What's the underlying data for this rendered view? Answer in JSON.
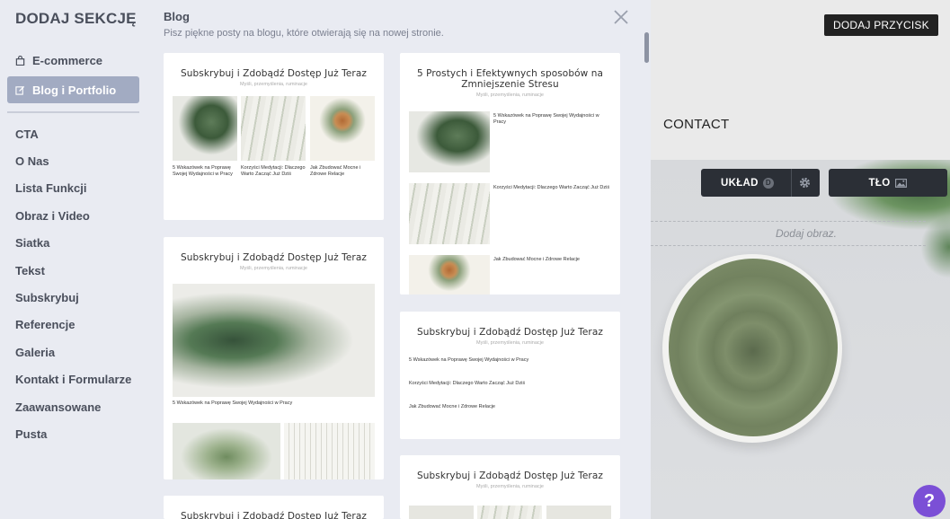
{
  "sidebar": {
    "title": "DODAJ SEKCJĘ",
    "categories": [
      {
        "label": "E-commerce",
        "icon": "shopping-bag-icon",
        "active": false
      },
      {
        "label": "Blog i Portfolio",
        "icon": "edit-icon",
        "active": true
      }
    ],
    "items": [
      "CTA",
      "O Nas",
      "Lista Funkcji",
      "Obraz i Video",
      "Siatka",
      "Tekst",
      "Subskrybuj",
      "Referencje",
      "Galeria",
      "Kontakt i Formularze",
      "Zaawansowane",
      "Pusta"
    ]
  },
  "panel": {
    "title": "Blog",
    "subtitle": "Pisz piękne posty na blogu, które otwierają się na nowej stronie.",
    "close_icon": "close-icon",
    "cards": {
      "c1": {
        "title": "Subskrybuj i Zdobądź Dostęp Już Teraz",
        "subtitle": "Myśli, przemyślenia, ruminacje"
      },
      "c2": {
        "title": "5 Prostych i Efektywnych sposobów na Zmniejszenie Stresu",
        "subtitle": "Myśli, przemyślenia, ruminacje"
      },
      "c3": {
        "title": "Subskrybuj i Zdobądź Dostęp Już Teraz",
        "subtitle": "Myśli, przemyślenia, ruminacje"
      },
      "c4": {
        "title": "Subskrybuj i Zdobądź Dostęp Już Teraz",
        "subtitle": "Myśli, przemyślenia, ruminacje"
      },
      "c5": {
        "title": "Subskrybuj i Zdobądź Dostęp Już Teraz",
        "subtitle": "Myśli, przemyślenia, ruminacje"
      },
      "c6": {
        "title": "Subskrybuj i Zdobądź Dostęp Już Teraz"
      }
    },
    "posts": {
      "p1": "5 Wskazówek na Poprawę Swojej Wydajności w Pracy",
      "p2": "Korzyści Medytacji: Dlaczego Warto Zacząć Już Dziś",
      "p3": "Jak Zbudować Mocne i Zdrowe Relacje"
    }
  },
  "preview": {
    "add_button": "DODAJ PRZYCISK",
    "contact": "CONTACT",
    "layout_label": "UKŁAD",
    "layout_badge": "D",
    "background_label": "TŁO",
    "add_image": "Dodaj obraz.",
    "help": "?"
  },
  "colors": {
    "accent": "#a2abc2",
    "help": "#7b4fd6",
    "toolbar": "#2b2f36"
  }
}
